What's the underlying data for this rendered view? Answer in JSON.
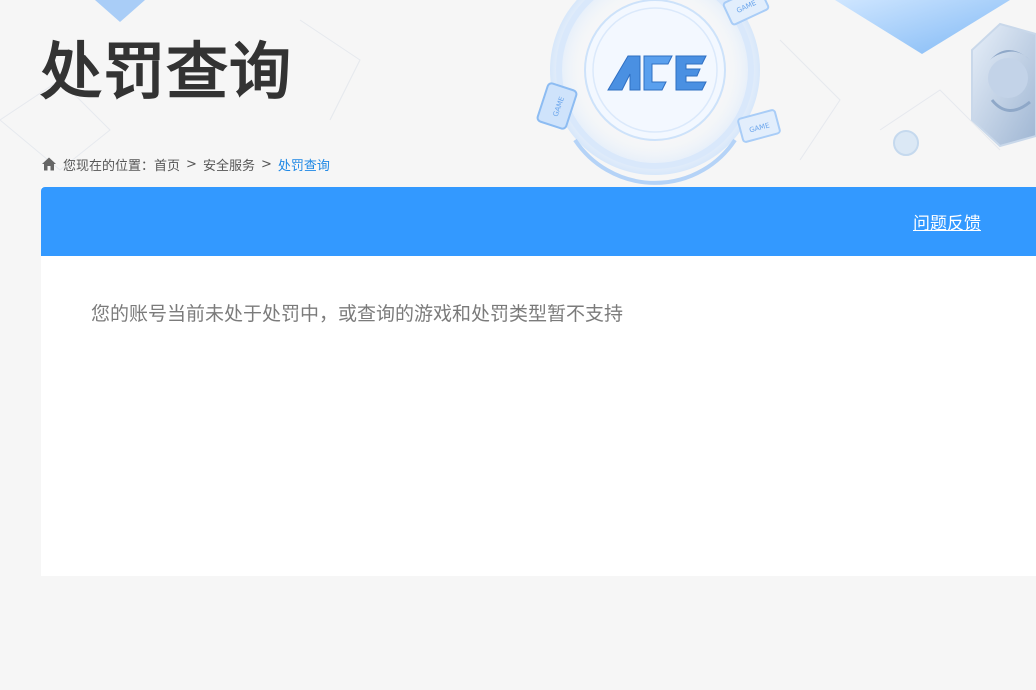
{
  "header": {
    "title": "处罚查询",
    "logo_text": "ACE",
    "decor_tags": [
      "GAME",
      "GAME",
      "GAME"
    ]
  },
  "breadcrumb": {
    "prefix": "您现在的位置：",
    "items": [
      "首页",
      "安全服务",
      "处罚查询"
    ],
    "separator": ">"
  },
  "panel": {
    "feedback_label": "问题反馈",
    "message": "您的账号当前未处于处罚中，或查询的游戏和处罚类型暂不支持"
  },
  "colors": {
    "accent": "#3399ff",
    "breadcrumb_current": "#1e88e5",
    "title": "#333333",
    "message": "#7b7b7b",
    "background": "#f6f6f6"
  }
}
